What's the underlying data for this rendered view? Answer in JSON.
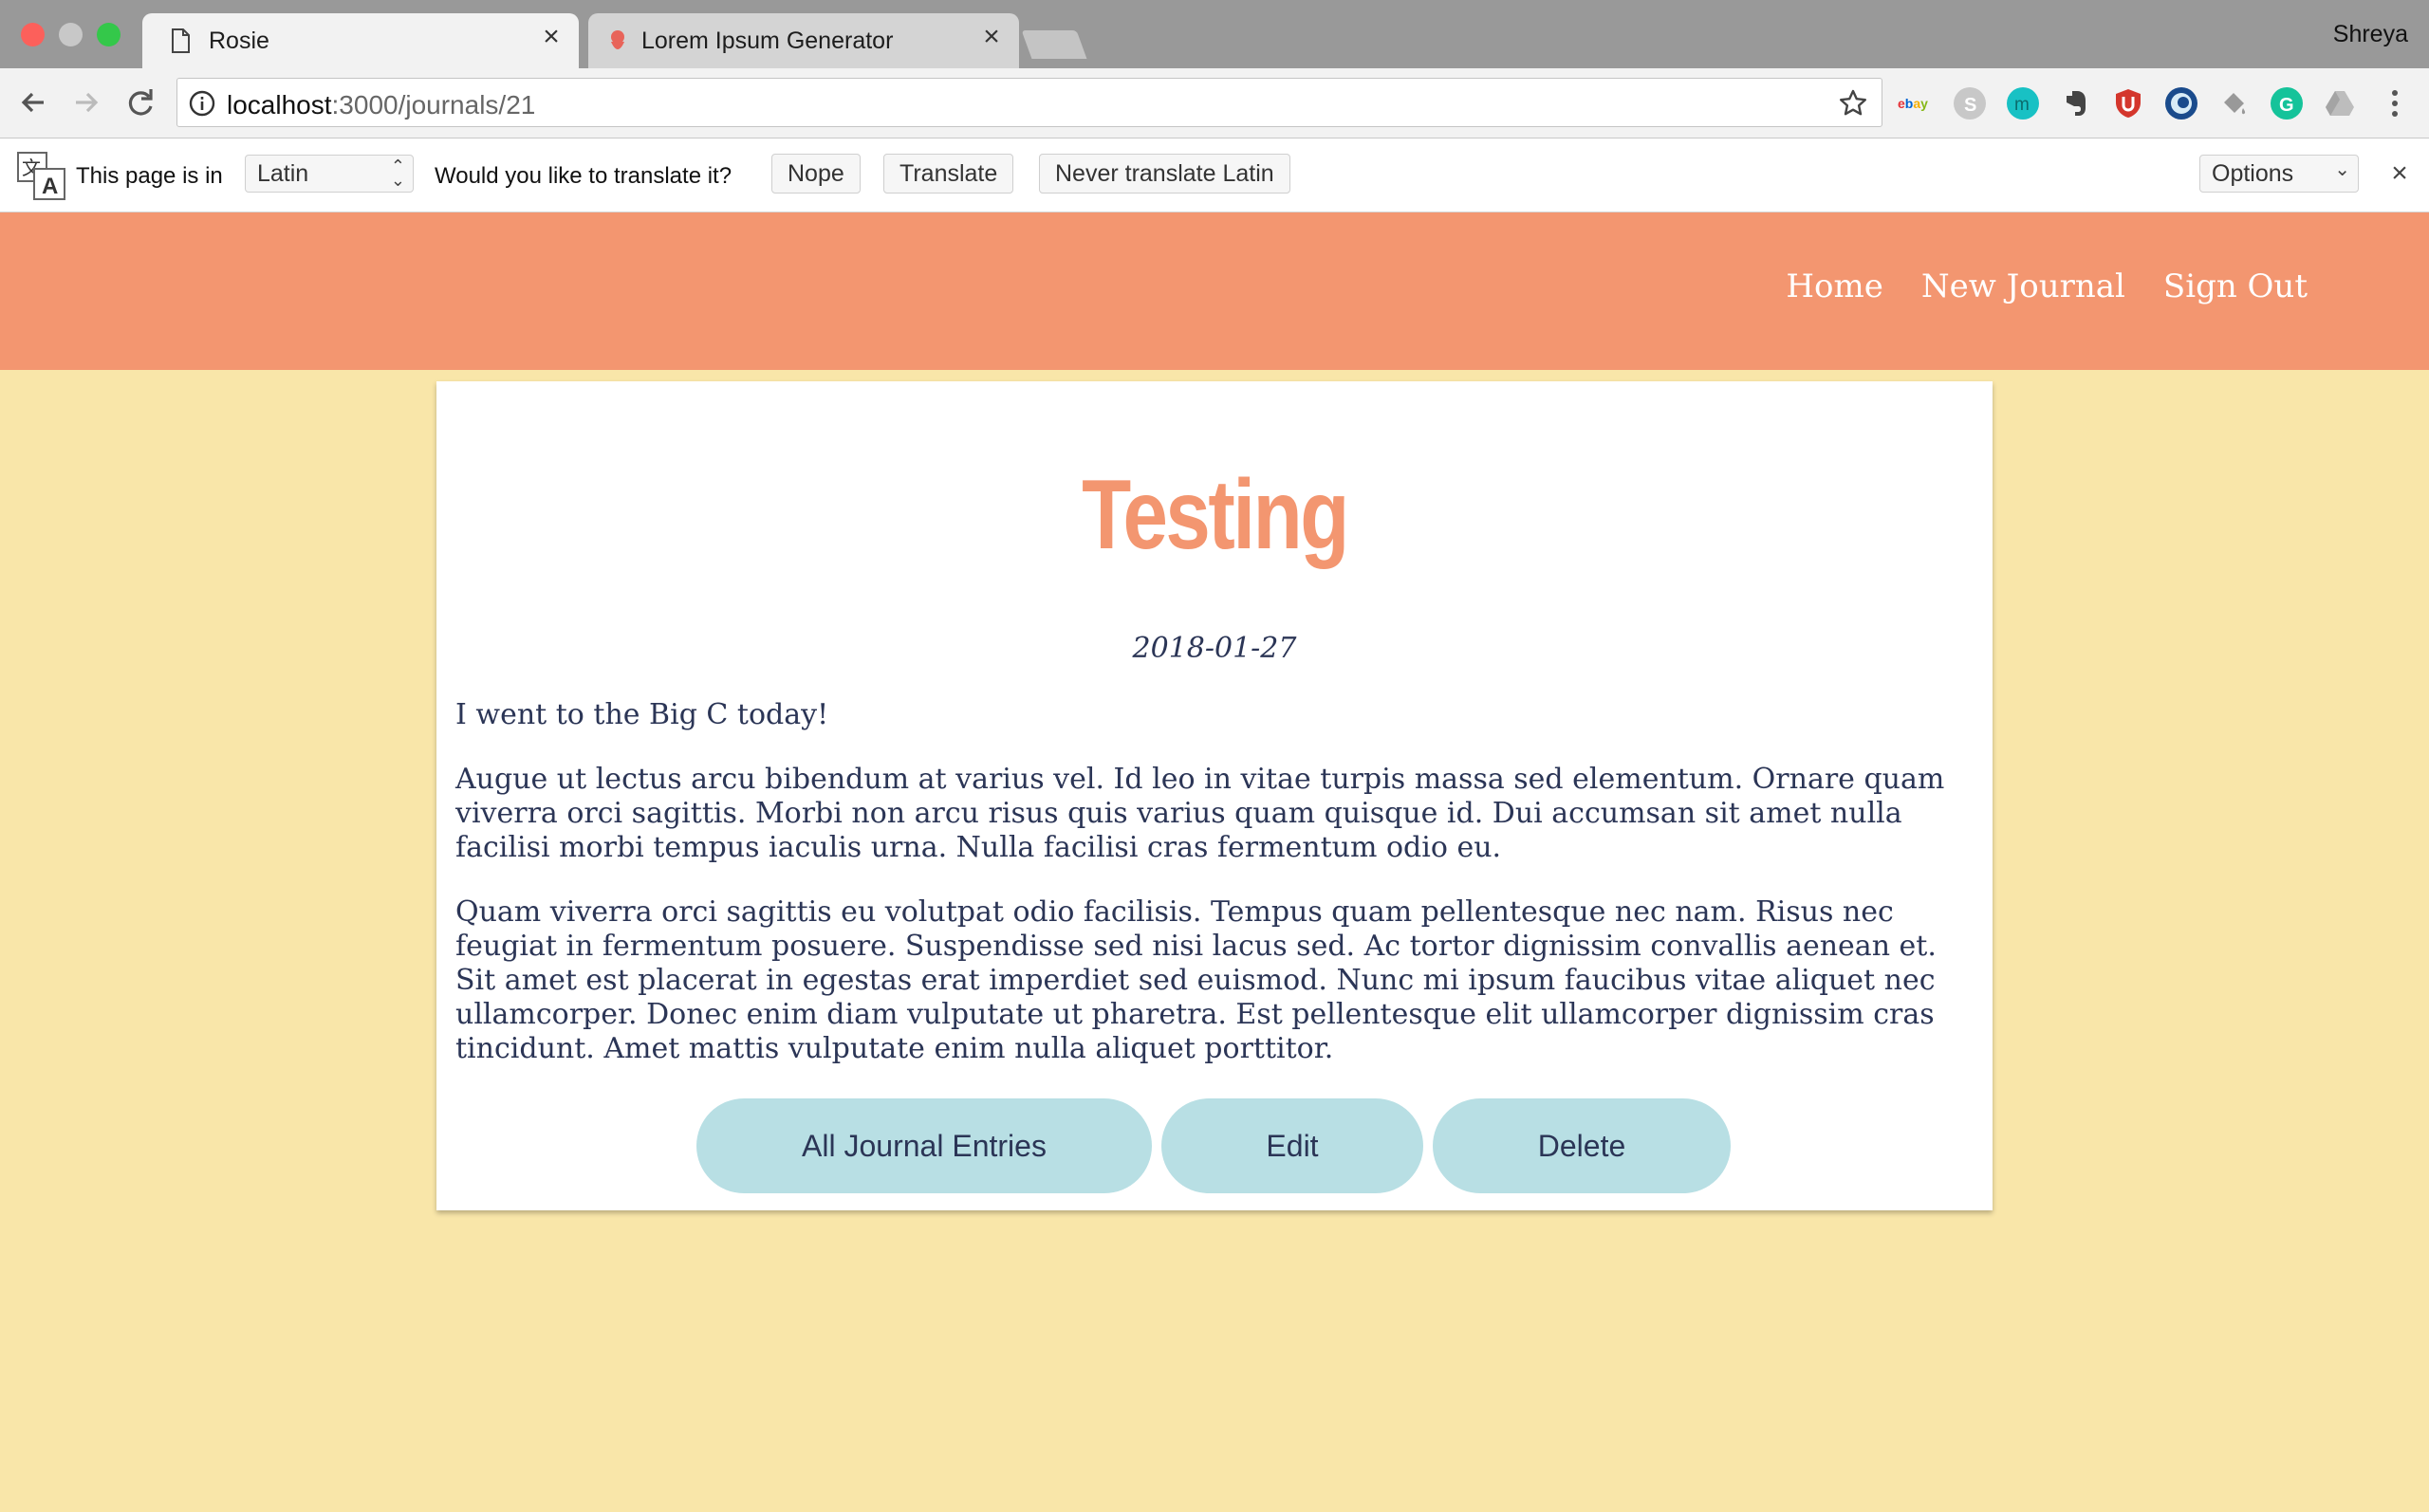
{
  "browser": {
    "tabs": [
      {
        "title": "Rosie",
        "active": true
      },
      {
        "title": "Lorem Ipsum Generator",
        "active": false
      }
    ],
    "profile_name": "Shreya",
    "address": {
      "host": "localhost",
      "path": ":3000/journals/21"
    },
    "extensions": [
      "ebay-icon",
      "skype-icon",
      "m-icon",
      "evernote-icon",
      "ublock-icon",
      "eye-icon",
      "paint-bucket-icon",
      "grammarly-icon",
      "drive-icon"
    ]
  },
  "translate_bar": {
    "page_is_in": "This page is in",
    "language": "Latin",
    "question": "Would you like to translate it?",
    "nope": "Nope",
    "translate": "Translate",
    "never": "Never translate Latin",
    "options": "Options"
  },
  "site": {
    "nav": {
      "home": "Home",
      "new_journal": "New Journal",
      "sign_out": "Sign Out"
    },
    "colors": {
      "header": "#f39670",
      "background": "#f9e6a9",
      "button": "#b8dfe4",
      "text": "#2b3556"
    }
  },
  "journal": {
    "title": "Testing",
    "date": "2018-01-27",
    "paragraphs": [
      "I went to the Big C today!",
      "Augue ut lectus arcu bibendum at varius vel. Id leo in vitae turpis massa sed elementum. Ornare quam viverra orci sagittis. Morbi non arcu risus quis varius quam quisque id. Dui accumsan sit amet nulla facilisi morbi tempus iaculis urna. Nulla facilisi cras fermentum odio eu.",
      "Quam viverra orci sagittis eu volutpat odio facilisis. Tempus quam pellentesque nec nam. Risus nec feugiat in fermentum posuere. Suspendisse sed nisi lacus sed. Ac tortor dignissim convallis aenean et. Sit amet est placerat in egestas erat imperdiet sed euismod. Nunc mi ipsum faucibus vitae aliquet nec ullamcorper. Donec enim diam vulputate ut pharetra. Est pellentesque elit ullamcorper dignissim cras tincidunt. Amet mattis vulputate enim nulla aliquet porttitor."
    ],
    "buttons": {
      "all": "All Journal Entries",
      "edit": "Edit",
      "delete": "Delete"
    }
  }
}
